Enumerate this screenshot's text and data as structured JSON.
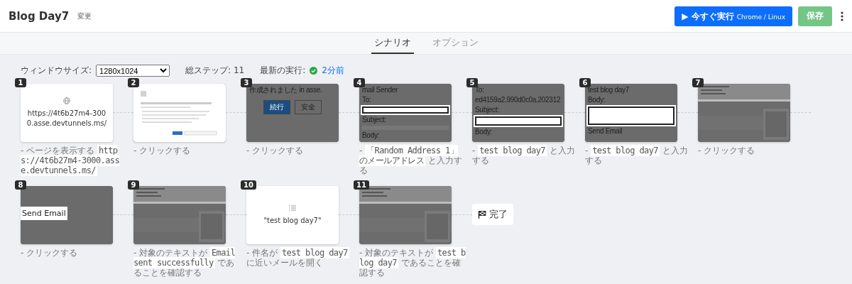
{
  "header": {
    "title": "Blog Day7",
    "rename_link": "変更",
    "run_button": {
      "label": "▶ 今すぐ実行",
      "detail": "Chrome / Linux"
    },
    "save_button": {
      "label": "保存",
      "disabled": true
    }
  },
  "tabs": [
    {
      "label": "シナリオ",
      "selected": true
    },
    {
      "label": "オプション",
      "selected": false
    }
  ],
  "settings": {
    "window_size_label": "ウィンドウサイズ:",
    "window_size": "1280x1024",
    "total_steps": "総ステップ: 11",
    "last_run_label": "最新の実行:",
    "last_run": "2分前"
  },
  "steps": [
    {
      "number": "1",
      "thumbnail": {
        "kind": "url",
        "text": "https://4t6b27m4-3000.asse.devtunnels.ms/"
      },
      "description": [
        {
          "kind": "text",
          "text": "- ページを表示する "
        },
        {
          "kind": "code",
          "text": "https://4t6b27m4-3000.asse.devtunnels.ms/"
        }
      ]
    },
    {
      "number": "2",
      "thumbnail": {
        "kind": "dialog-picture"
      },
      "description": [
        {
          "kind": "text",
          "text": "- クリックする"
        }
      ]
    },
    {
      "number": "3",
      "thumbnail": {
        "kind": "screenshot",
        "items": [
          {
            "kind": "label",
            "text": "作成されました in asse."
          },
          {
            "kind": "buttons",
            "text": "続行",
            "extra": "安全"
          }
        ]
      },
      "description": [
        {
          "kind": "text",
          "text": "- クリックする"
        }
      ]
    },
    {
      "number": "4",
      "thumbnail": {
        "kind": "screenshot",
        "items": [
          {
            "kind": "label",
            "text": "mail Sender"
          },
          {
            "kind": "label",
            "text": "To:"
          },
          {
            "kind": "input"
          },
          {
            "kind": "label",
            "text": "Subject:"
          },
          {
            "kind": "blank"
          },
          {
            "kind": "label",
            "text": "Body:"
          }
        ]
      },
      "description": [
        {
          "kind": "text",
          "text": "- "
        },
        {
          "kind": "code",
          "text": "「Random Address 1」のメールアドレス"
        },
        {
          "kind": "text",
          "text": " と入力する"
        }
      ]
    },
    {
      "number": "5",
      "thumbnail": {
        "kind": "screenshot",
        "items": [
          {
            "kind": "label",
            "text": "To:"
          },
          {
            "kind": "label",
            "text": "ed4159a2.990d0c0a.202312"
          },
          {
            "kind": "label",
            "text": "Subject:"
          },
          {
            "kind": "input"
          },
          {
            "kind": "label",
            "text": "Body:"
          }
        ]
      },
      "description": [
        {
          "kind": "text",
          "text": "- "
        },
        {
          "kind": "code",
          "text": "test blog day7"
        },
        {
          "kind": "text",
          "text": " と入力する"
        }
      ]
    },
    {
      "number": "6",
      "thumbnail": {
        "kind": "screenshot",
        "items": [
          {
            "kind": "label",
            "text": "test blog day7"
          },
          {
            "kind": "label",
            "text": "Body:"
          },
          {
            "kind": "textarea"
          },
          {
            "kind": "label",
            "text": "Send Email"
          }
        ]
      },
      "description": [
        {
          "kind": "text",
          "text": "- "
        },
        {
          "kind": "code",
          "text": "test blog day7"
        },
        {
          "kind": "text",
          "text": " と入力する"
        }
      ]
    },
    {
      "number": "7",
      "thumbnail": {
        "kind": "page-picture"
      },
      "description": [
        {
          "kind": "text",
          "text": "- クリックする"
        }
      ]
    },
    {
      "number": "8",
      "thumbnail": {
        "kind": "screenshot",
        "items": [
          {
            "kind": "spacer"
          },
          {
            "kind": "highlight",
            "text": "Send Email"
          }
        ]
      },
      "description": [
        {
          "kind": "text",
          "text": "- クリックする"
        }
      ]
    },
    {
      "number": "9",
      "thumbnail": {
        "kind": "page-picture"
      },
      "description": [
        {
          "kind": "text",
          "text": "- 対象のテキストが "
        },
        {
          "kind": "code",
          "text": "Email sent successfully"
        },
        {
          "kind": "text",
          "text": " であることを確認する"
        }
      ]
    },
    {
      "number": "10",
      "thumbnail": {
        "kind": "subject",
        "text": "\"test blog day7\""
      },
      "description": [
        {
          "kind": "text",
          "text": "- 件名が "
        },
        {
          "kind": "code",
          "text": "test blog day7"
        },
        {
          "kind": "text",
          "text": " に近いメールを開く"
        }
      ]
    },
    {
      "number": "11",
      "thumbnail": {
        "kind": "page-picture"
      },
      "description": [
        {
          "kind": "text",
          "text": "- 対象のテキストが "
        },
        {
          "kind": "code",
          "text": "test blog day7"
        },
        {
          "kind": "text",
          "text": " であることを確認する"
        }
      ]
    }
  ],
  "finish": {
    "label": "完了"
  }
}
